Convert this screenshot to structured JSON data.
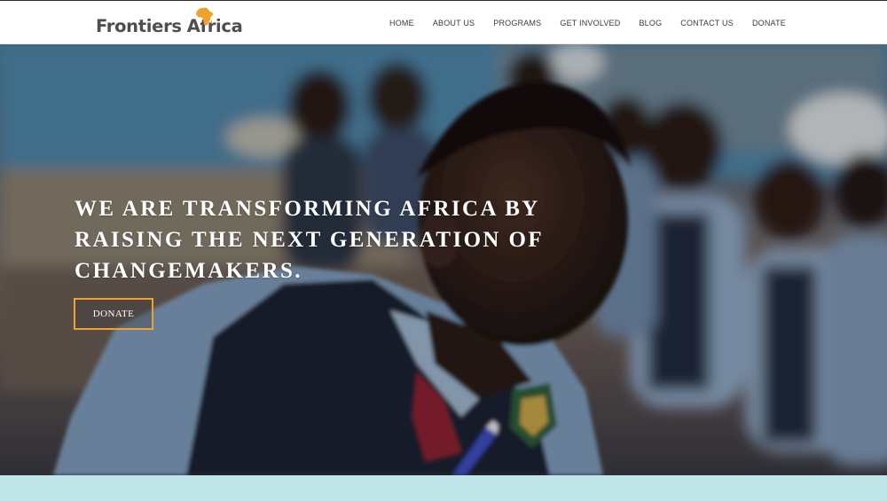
{
  "brand": {
    "name_part_1": "Frontiers",
    "name_part_2": "Africa",
    "icon": "africa-continent-icon",
    "icon_color": "#f0a32a",
    "text_color": "#4e4e4e"
  },
  "nav": {
    "items": [
      {
        "label": "HOME"
      },
      {
        "label": "ABOUT US"
      },
      {
        "label": "PROGRAMS"
      },
      {
        "label": "GET INVOLVED"
      },
      {
        "label": "BLOG"
      },
      {
        "label": "CONTACT US"
      },
      {
        "label": "DONATE"
      }
    ]
  },
  "hero": {
    "heading_lines": [
      "WE ARE TRANSFORMING AFRICA BY",
      "RAISING THE NEXT GENERATION OF",
      "CHANGEMAKERS."
    ],
    "cta_label": "DONATE",
    "cta_border_color": "#f0a32a"
  },
  "colors": {
    "band": "#bfe5e8"
  }
}
